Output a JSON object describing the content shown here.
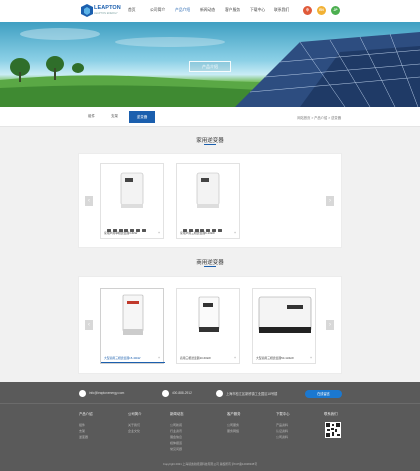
{
  "header": {
    "logo_text": "LEAPTON",
    "logo_sub": "LEAPTON ENERGY",
    "nav": [
      "首页",
      "公司简介",
      "产品介绍",
      "新闻动态",
      "客户服务",
      "下载中心",
      "联系我们"
    ],
    "active_index": 2,
    "languages": [
      {
        "label": "中",
        "color": "#e05a3a"
      },
      {
        "label": "EN",
        "color": "#f2b134"
      },
      {
        "label": "JP",
        "color": "#4caf50"
      }
    ]
  },
  "banner": {
    "title": "产品介绍"
  },
  "subnav": {
    "tabs": [
      "组件",
      "支架",
      "逆变器"
    ],
    "active_index": 2,
    "breadcrumb": "网站首页 > 产品介绍 > 逆变器"
  },
  "sections": [
    {
      "title": "家用逆变器",
      "cards": [
        {
          "label": "家用户用单相逆变器3-6kW"
        },
        {
          "label": "家用户用三相逆变器6-10kW"
        }
      ]
    },
    {
      "title": "商用逆变器",
      "cards": [
        {
          "label": "大型商用三相逆变器15-40kW"
        },
        {
          "label": "商用三相逆变器20-60kW"
        },
        {
          "label": "大型商用三相逆变器50-110kW"
        }
      ]
    }
  ],
  "footer": {
    "email": "info@leaptonenergy.com",
    "phone": "400-888-2912",
    "address": "上海市松江区新桥镇工业园区18号楼",
    "message_btn": "在线留言",
    "columns": [
      {
        "head": "产品介绍",
        "items": [
          "组件",
          "支架",
          "逆变器"
        ]
      },
      {
        "head": "公司简介",
        "items": [
          "关于我们",
          "企业文化"
        ]
      },
      {
        "head": "新闻动态",
        "items": [
          "公司新闻",
          "行业资讯",
          "展会信息",
          "媒体报道",
          "常见问题"
        ]
      },
      {
        "head": "客户服务",
        "items": [
          "公司服务",
          "服务网络"
        ]
      },
      {
        "head": "下载中心",
        "items": [
          "产品资料",
          "认证资料",
          "公司资料"
        ]
      },
      {
        "head": "联系我们",
        "items": []
      }
    ],
    "copyright": "Copyright 2021 上海领逸新能源科技有限公司 版权所有 沪ICP备12028345号"
  }
}
